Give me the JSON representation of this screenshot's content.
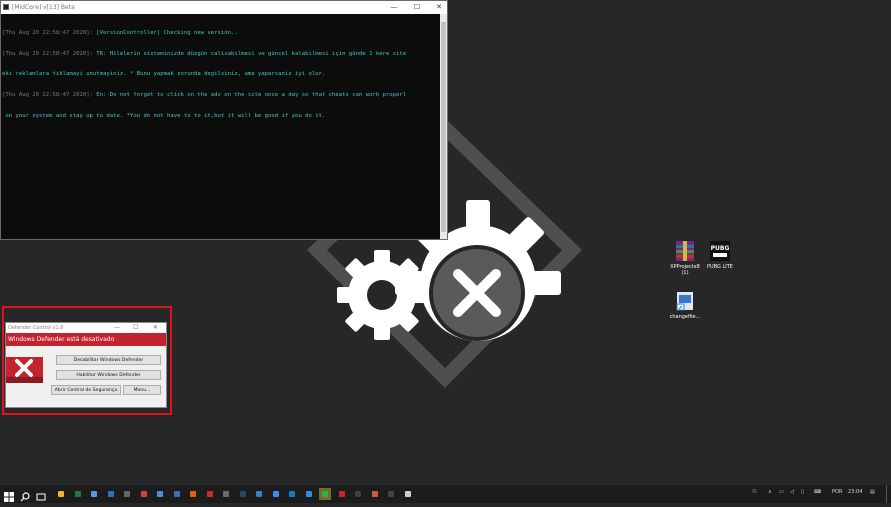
{
  "console": {
    "title": "[MidCore] v[13] Beta",
    "controls": {
      "minimize": "—",
      "maximize": "☐",
      "close": "✕"
    },
    "lines": [
      {
        "ts": "[Thu Aug 20 22:58:47 2020]:",
        "msg": " [VersionController] Checking new version.."
      },
      {
        "ts": "[Thu Aug 20 22:58:47 2020]:",
        "msg": " TR: Hileler­in sisteminizde düzgün calisabilmesi ve güncel kalabilmesi için günde 1 kere site"
      },
      {
        "ts": "",
        "msg": "eki reklamlara tiklamayi unutmayiniz. * Bunu yapmak zorunda degilsiniz, ama yaparsaniz iyi olur."
      },
      {
        "ts": "[Thu Aug 20 22:58:47 2020]:",
        "msg": " En: Do not forget to click on the adv on the site once a day so that cheats can work properl"
      },
      {
        "ts": "",
        "msg": " on your system and stay up to date. *You do not have to to it,but it will be good if you do it."
      }
    ]
  },
  "desktop_icons": [
    {
      "label": "XPProjectx8 (1)",
      "icon": "winrar-archive-icon",
      "color": "#8a2f8a"
    },
    {
      "label": "PUBG LITE",
      "icon": "pubg-icon",
      "color": "#111111"
    },
    {
      "label": "changefile...",
      "icon": "file-shortcut-icon",
      "color": "#3a78c9"
    }
  ],
  "defender": {
    "title": "Defender Control v1.6",
    "status": "Windows Defender está desativado",
    "buttons": {
      "disable": "Desabilitar Windows Defender",
      "enable": "Habilitar Windows Defender",
      "security_center": "Abrir Central de Segurança",
      "menu": "Menu..."
    },
    "status_color": "#c3232d"
  },
  "taskbar": {
    "language": "POR",
    "time": "23:04",
    "apps": [
      {
        "icon": "file-explorer-icon",
        "color": "#e8b52b"
      },
      {
        "icon": "excel-icon",
        "color": "#1f7a3f"
      },
      {
        "icon": "photos-icon",
        "color": "#5b9bd5"
      },
      {
        "icon": "mail-icon",
        "color": "#2b73c8"
      },
      {
        "icon": "calculator-icon",
        "color": "#666666"
      },
      {
        "icon": "car-game-icon",
        "color": "#d04040"
      },
      {
        "icon": "app-icon",
        "color": "#4a90d9"
      },
      {
        "icon": "app-icon",
        "color": "#3b6fb6"
      },
      {
        "icon": "firefox-icon",
        "color": "#e66000"
      },
      {
        "icon": "app-icon",
        "color": "#c83030"
      },
      {
        "icon": "app-icon",
        "color": "#6b6b6b"
      },
      {
        "icon": "steam-icon",
        "color": "#2a475e"
      },
      {
        "icon": "app-icon",
        "color": "#3a80c0"
      },
      {
        "icon": "chrome-icon",
        "color": "#4285f4"
      },
      {
        "icon": "edge-icon",
        "color": "#0f7cc4"
      },
      {
        "icon": "app-icon",
        "color": "#2b8cd9"
      },
      {
        "icon": "spotify-icon",
        "color": "#1db954"
      },
      {
        "icon": "opera-icon",
        "color": "#d0212c"
      },
      {
        "icon": "app-icon",
        "color": "#404040"
      },
      {
        "icon": "app-icon",
        "color": "#d2593b"
      },
      {
        "icon": "app-icon",
        "color": "#444444"
      },
      {
        "icon": "console-icon",
        "color": "#cccccc"
      }
    ]
  }
}
